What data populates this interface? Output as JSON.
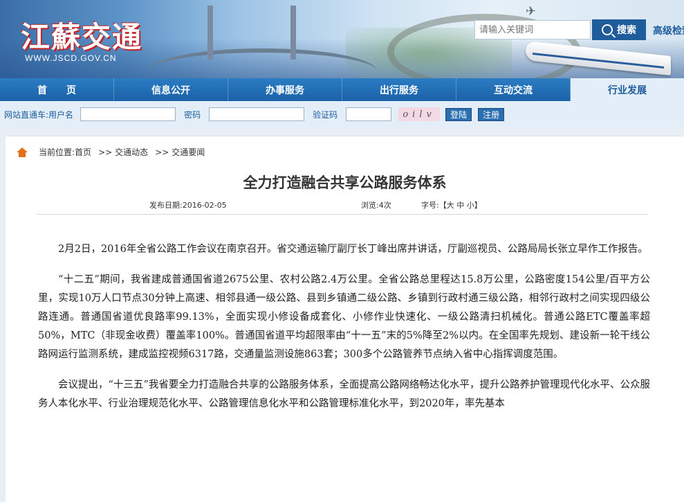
{
  "header": {
    "logo_text": "江蘇交通",
    "logo_url": "WWW.JSCD.GOV.CN",
    "search_placeholder": "请输入关键词",
    "search_button": "搜索",
    "advanced_search": "高级检索"
  },
  "nav": {
    "items": [
      "首　　页",
      "信息公开",
      "办事服务",
      "出行服务",
      "互动交流",
      "行业发展"
    ],
    "active_index": 5
  },
  "login": {
    "direct_label": "网站直通车:",
    "username_label": "用户名",
    "password_label": "密码",
    "captcha_label": "验证码",
    "captcha_text": "oilv",
    "login_button": "登陆",
    "register_button": "注册"
  },
  "breadcrumb": {
    "current_label": "当前位置:",
    "items": [
      "首页",
      "交通动态",
      "交通要闻"
    ],
    "separator": ">>"
  },
  "article": {
    "title": "全力打造融合共享公路服务体系",
    "publish_date_label": "发布日期:",
    "publish_date": "2016-02-05",
    "views_label": "浏览:",
    "views": "4次",
    "font_size_label": "字号:【大 中 小】",
    "paragraphs": [
      "2月2日，2016年全省公路工作会议在南京召开。省交通运输厅副厅长丁峰出席并讲话，厅副巡视员、公路局局长张立早作工作报告。",
      "“十二五”期间，我省建成普通国省道2675公里、农村公路2.4万公里。全省公路总里程达15.8万公里，公路密度154公里/百平方公里，实现10万人口节点30分钟上高速、相邻县通一级公路、县到乡镇通二级公路、乡镇到行政村通三级公路，相邻行政村之间实现四级公路连通。普通国省道优良路率99.13%，全面实现小修设备成套化、小修作业快速化、一级公路清扫机械化。普通公路ETC覆盖率超50%，MTC（非现金收费）覆盖率100%。普通国省道平均超限率由“十一五”末的5%降至2%以内。在全国率先规划、建设新一轮干线公路网运行监测系统，建成监控视频6317路，交通量监测设施863套；300多个公路管养节点纳入省中心指挥调度范围。",
      "会议提出，“十三五”我省要全力打造融合共享的公路服务体系，全面提高公路网络畅达化水平，提升公路养护管理现代化水平、公众服务人本化水平、行业治理规范化水平、公路管理信息化水平和公路管理标准化水平，到2020年，率先基本"
    ]
  },
  "colors": {
    "nav_blue": "#1b62a8",
    "active_tab_bg": "#e3eef8",
    "home_icon": "#e0701c"
  }
}
